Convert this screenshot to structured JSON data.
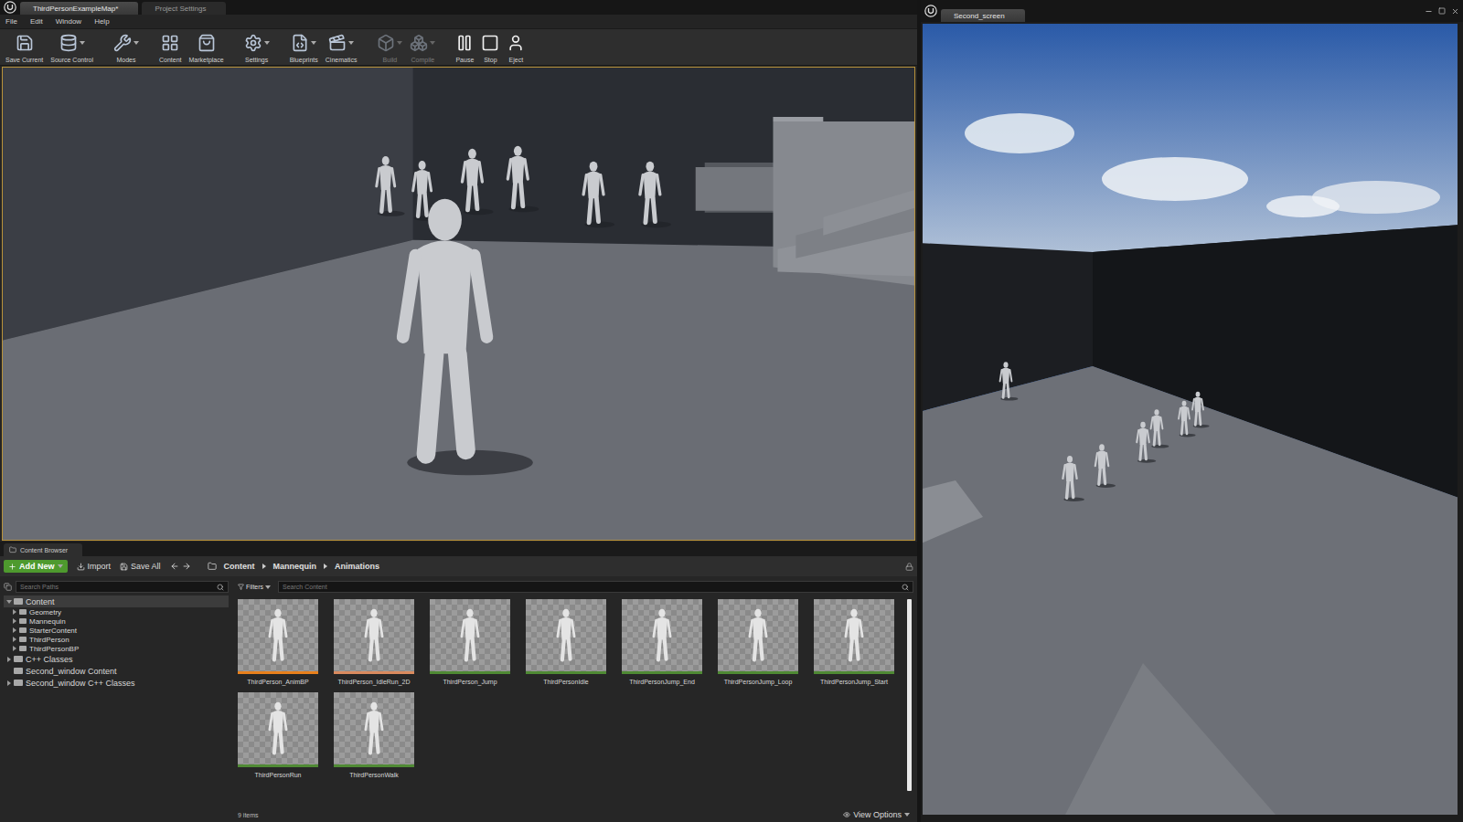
{
  "main_window": {
    "tabs": [
      {
        "label": "ThirdPersonExampleMap*",
        "selected": true
      },
      {
        "label": "Project Settings",
        "selected": false
      }
    ],
    "menu": [
      "File",
      "Edit",
      "Window",
      "Help"
    ],
    "toolbar": [
      {
        "label": "Save Current",
        "menu": false,
        "disabled": false
      },
      {
        "label": "Source Control",
        "menu": true,
        "disabled": false
      },
      {
        "label": "Modes",
        "menu": true,
        "disabled": false
      },
      {
        "label": "Content",
        "menu": false,
        "disabled": false
      },
      {
        "label": "Marketplace",
        "menu": false,
        "disabled": false
      },
      {
        "label": "Settings",
        "menu": true,
        "disabled": false
      },
      {
        "label": "Blueprints",
        "menu": true,
        "disabled": false
      },
      {
        "label": "Cinematics",
        "menu": true,
        "disabled": false
      },
      {
        "label": "Build",
        "menu": true,
        "disabled": true
      },
      {
        "label": "Compile",
        "menu": true,
        "disabled": true
      },
      {
        "label": "Pause",
        "menu": false,
        "disabled": false
      },
      {
        "label": "Stop",
        "menu": false,
        "disabled": false
      },
      {
        "label": "Eject",
        "menu": false,
        "disabled": false
      }
    ]
  },
  "content_browser": {
    "tab": "Content Browser",
    "add_new": "Add New",
    "import": "Import",
    "save_all": "Save All",
    "breadcrumbs": [
      "Content",
      "Mannequin",
      "Animations"
    ],
    "path_search": {
      "placeholder": "Search Paths"
    },
    "tree": [
      {
        "label": "Content",
        "depth": 0,
        "expandable": true,
        "expanded": true
      },
      {
        "label": "Geometry",
        "depth": 1,
        "expandable": true,
        "expanded": false
      },
      {
        "label": "Mannequin",
        "depth": 1,
        "expandable": true,
        "expanded": false
      },
      {
        "label": "StarterContent",
        "depth": 1,
        "expandable": true,
        "expanded": false
      },
      {
        "label": "ThirdPerson",
        "depth": 1,
        "expandable": true,
        "expanded": false
      },
      {
        "label": "ThirdPersonBP",
        "depth": 1,
        "expandable": true,
        "expanded": false
      },
      {
        "label": "C++ Classes",
        "depth": 0,
        "expandable": true,
        "expanded": false
      },
      {
        "label": "Second_window Content",
        "depth": 0,
        "expandable": false,
        "expanded": false
      },
      {
        "label": "Second_window C++ Classes",
        "depth": 0,
        "expandable": true,
        "expanded": false
      }
    ],
    "filters": "Filters",
    "search": {
      "placeholder": "Search Content"
    },
    "assets": [
      {
        "name": "ThirdPerson_AnimBP",
        "color": "#e8801c"
      },
      {
        "name": "ThirdPerson_IdleRun_2D",
        "color": "#d98a5e"
      },
      {
        "name": "ThirdPerson_Jump",
        "color": "#4f8a34"
      },
      {
        "name": "ThirdPersonIdle",
        "color": "#4f8a34"
      },
      {
        "name": "ThirdPersonJump_End",
        "color": "#4f8a34"
      },
      {
        "name": "ThirdPersonJump_Loop",
        "color": "#4f8a34"
      },
      {
        "name": "ThirdPersonJump_Start",
        "color": "#4f8a34"
      },
      {
        "name": "ThirdPersonRun",
        "color": "#4f8a34"
      },
      {
        "name": "ThirdPersonWalk",
        "color": "#4f8a34"
      }
    ],
    "count": "9 items",
    "view_options": "View Options"
  },
  "second_window": {
    "tab": "Second_screen"
  }
}
